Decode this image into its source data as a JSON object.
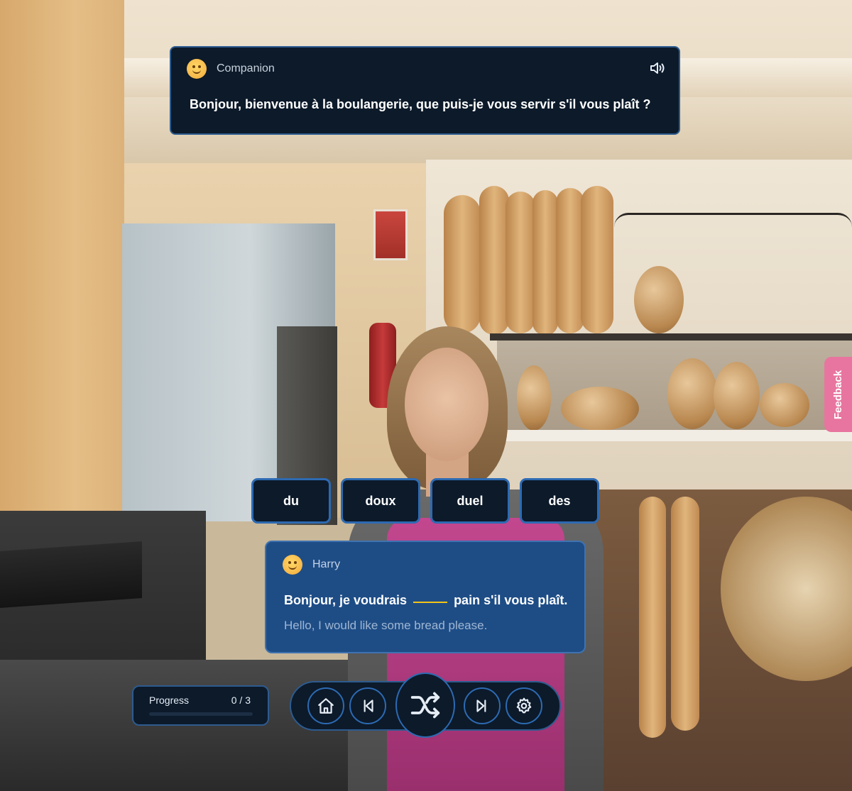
{
  "companion": {
    "name": "Companion",
    "message": "Bonjour, bienvenue à la boulangerie, que puis-je vous servir s'il vous plaît ?",
    "audio_icon": "speaker-volume-icon",
    "avatar_icon": "smiling-face-icon"
  },
  "word_choices": [
    "du",
    "doux",
    "duel",
    "des"
  ],
  "harry": {
    "name": "Harry",
    "sentence_before": "Bonjour, je voudrais",
    "sentence_after": "pain s'il vous plaît.",
    "translation": "Hello, I would like some bread please.",
    "avatar_icon": "smiling-face-icon"
  },
  "progress": {
    "label": "Progress",
    "count_text": "0 / 3",
    "value": 0
  },
  "nav": {
    "buttons": [
      "home-icon",
      "skip-back-icon",
      "shuffle-icon",
      "skip-forward-icon",
      "settings-icon"
    ]
  },
  "feedback": {
    "label": "Feedback"
  },
  "colors": {
    "panel_bg": "#0c1a2a",
    "panel_border": "#2d6ab2",
    "user_card_bg": "#1e4d86",
    "blank_underline": "#f0c419",
    "feedback_bg": "#e8759f"
  }
}
